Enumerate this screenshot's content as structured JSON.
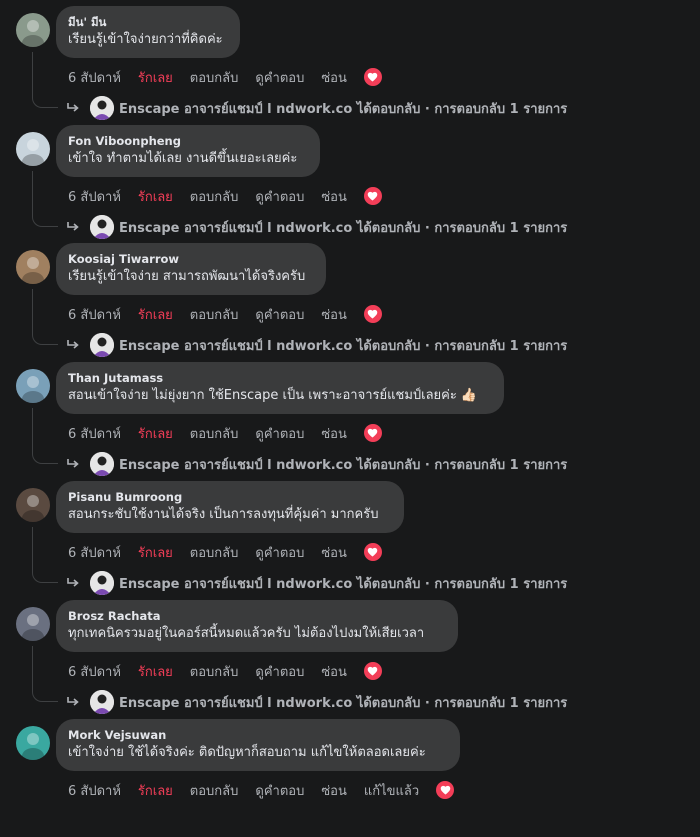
{
  "actions": {
    "time": "6 สัปดาห์",
    "love": "รักเลย",
    "reply": "ตอบกลับ",
    "translate": "ดูคำตอบ",
    "hide": "ซ่อน",
    "edited": "แก้ไขแล้ว"
  },
  "reply_summary": "Enscape อาจารย์แชมป์ l ndwork.co ได้ตอบกลับ · การตอบกลับ 1 รายการ",
  "colors": {
    "background": "#18191a",
    "bubble": "#3a3b3c",
    "love": "#f33e58",
    "muted": "#b0b3b8"
  },
  "comments": [
    {
      "author": "มีน' มีน",
      "text": "เรียนรู้เข้าใจง่ายกว่าที่คิดค่ะ",
      "emoji": "",
      "has_reply": true,
      "edited": false
    },
    {
      "author": "Fon Viboonpheng",
      "text": "เข้าใจ ทำตามได้เลย งานดีขึ้นเยอะเลยค่ะ",
      "emoji": "",
      "has_reply": true,
      "edited": false
    },
    {
      "author": "Koosiaj Tiwarrow",
      "text": "เรียนรู้เข้าใจง่าย สามารถพัฒนาได้จริงครับ",
      "emoji": "",
      "has_reply": true,
      "edited": false
    },
    {
      "author": "Than Jutamass",
      "text": "สอนเข้าใจง่าย ไม่ยุ่งยาก ใช้Enscape เป็น เพราะอาจารย์แชมป์เลยค่ะ",
      "emoji": "👍🏻",
      "has_reply": true,
      "edited": false
    },
    {
      "author": "Pisanu Bumroong",
      "text": "สอนกระชับใช้งานได้จริง เป็นการลงทุนที่คุ้มค่า มากครับ",
      "emoji": "",
      "has_reply": true,
      "edited": false
    },
    {
      "author": "Brosz Rachata",
      "text": "ทุกเทคนิครวมอยู่ในคอร์สนี้หมดแล้วครับ ไม่ต้องไปงมให้เสียเวลา",
      "emoji": "",
      "has_reply": true,
      "edited": false
    },
    {
      "author": "Mork Vejsuwan",
      "text": "เข้าใจง่าย ใช้ได้จริงค่ะ ติดปัญหาก็สอบถาม แก้ไขให้ตลอดเลยค่ะ",
      "emoji": "",
      "has_reply": false,
      "edited": true
    }
  ]
}
